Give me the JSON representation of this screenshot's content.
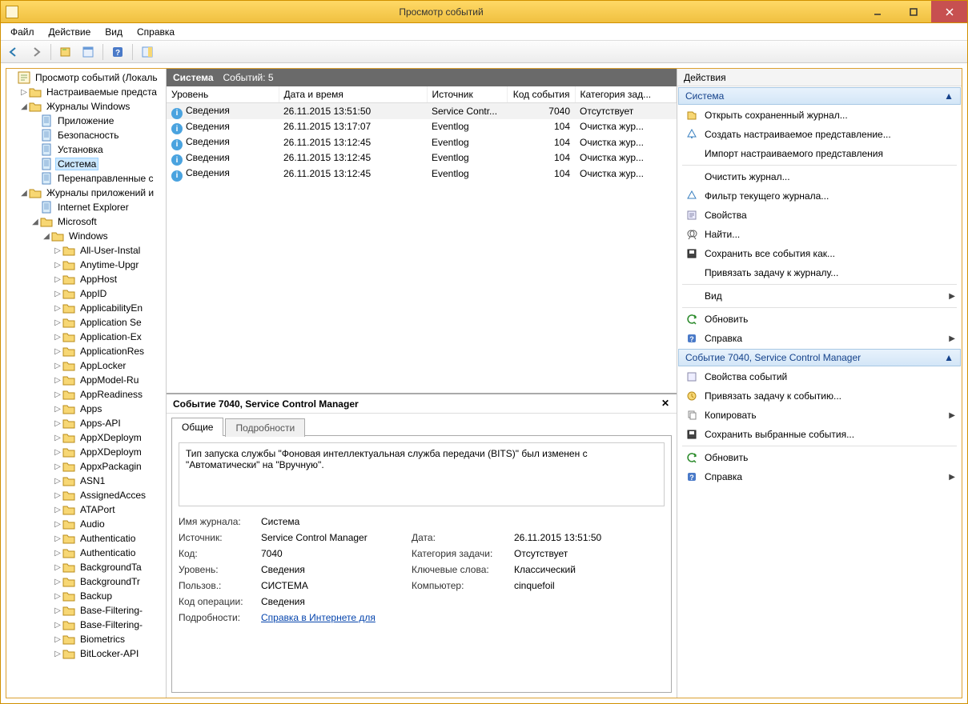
{
  "window": {
    "title": "Просмотр событий"
  },
  "menu": {
    "file": "Файл",
    "action": "Действие",
    "view": "Вид",
    "help": "Справка"
  },
  "tree": {
    "root": "Просмотр событий (Локаль",
    "custom_views": "Настраиваемые предста",
    "windows_logs": "Журналы Windows",
    "wl_app": "Приложение",
    "wl_security": "Безопасность",
    "wl_setup": "Установка",
    "wl_system": "Система",
    "wl_forwarded": "Перенаправленные с",
    "app_logs": "Журналы приложений и",
    "ie": "Internet Explorer",
    "microsoft": "Microsoft",
    "windows": "Windows",
    "subnodes": [
      "All-User-Instal",
      "Anytime-Upgr",
      "AppHost",
      "AppID",
      "ApplicabilityEn",
      "Application Se",
      "Application-Ex",
      "ApplicationRes",
      "AppLocker",
      "AppModel-Ru",
      "AppReadiness",
      "Apps",
      "Apps-API",
      "AppXDeploym",
      "AppXDeploym",
      "AppxPackagin",
      "ASN1",
      "AssignedAcces",
      "ATAPort",
      "Audio",
      "Authenticatio",
      "Authenticatio",
      "BackgroundTa",
      "BackgroundTr",
      "Backup",
      "Base-Filtering-",
      "Base-Filtering-",
      "Biometrics",
      "BitLocker-API"
    ]
  },
  "center": {
    "header_label": "Система",
    "header_count": "Событий: 5",
    "columns": {
      "level": "Уровень",
      "datetime": "Дата и время",
      "source": "Источник",
      "eventid": "Код события",
      "category": "Категория зад..."
    },
    "rows": [
      {
        "level": "Сведения",
        "dt": "26.11.2015 13:51:50",
        "src": "Service Contr...",
        "id": "7040",
        "cat": "Отсутствует"
      },
      {
        "level": "Сведения",
        "dt": "26.11.2015 13:17:07",
        "src": "Eventlog",
        "id": "104",
        "cat": "Очистка жур..."
      },
      {
        "level": "Сведения",
        "dt": "26.11.2015 13:12:45",
        "src": "Eventlog",
        "id": "104",
        "cat": "Очистка жур..."
      },
      {
        "level": "Сведения",
        "dt": "26.11.2015 13:12:45",
        "src": "Eventlog",
        "id": "104",
        "cat": "Очистка жур..."
      },
      {
        "level": "Сведения",
        "dt": "26.11.2015 13:12:45",
        "src": "Eventlog",
        "id": "104",
        "cat": "Очистка жур..."
      }
    ]
  },
  "detail": {
    "title": "Событие 7040, Service Control Manager",
    "tab_general": "Общие",
    "tab_details": "Подробности",
    "description": "Тип запуска службы \"Фоновая интеллектуальная служба передачи (BITS)\" был изменен с \"Автоматически\" на \"Вручную\".",
    "labels": {
      "journal": "Имя журнала:",
      "source": "Источник:",
      "code": "Код:",
      "level": "Уровень:",
      "user": "Пользов.:",
      "opcode": "Код операции:",
      "moreinfo": "Подробности:",
      "date": "Дата:",
      "category": "Категория задачи:",
      "keywords": "Ключевые слова:",
      "computer": "Компьютер:"
    },
    "values": {
      "journal": "Система",
      "source": "Service Control Manager",
      "code": "7040",
      "level": "Сведения",
      "user": "СИСТЕМА",
      "opcode": "Сведения",
      "date": "26.11.2015 13:51:50",
      "category": "Отсутствует",
      "keywords": "Классический",
      "computer": "cinquefoil",
      "moreinfo_link": "Справка в Интернете для "
    }
  },
  "actions": {
    "pane_title": "Действия",
    "section1": "Система",
    "section2": "Событие 7040, Service Control Manager",
    "items1": [
      "Открыть сохраненный журнал...",
      "Создать настраиваемое представление...",
      "Импорт настраиваемого представления",
      "Очистить журнал...",
      "Фильтр текущего журнала...",
      "Свойства",
      "Найти...",
      "Сохранить все события как...",
      "Привязать задачу к журналу...",
      "Вид",
      "Обновить",
      "Справка"
    ],
    "items2": [
      "Свойства событий",
      "Привязать задачу к событию...",
      "Копировать",
      "Сохранить выбранные события...",
      "Обновить",
      "Справка"
    ]
  }
}
